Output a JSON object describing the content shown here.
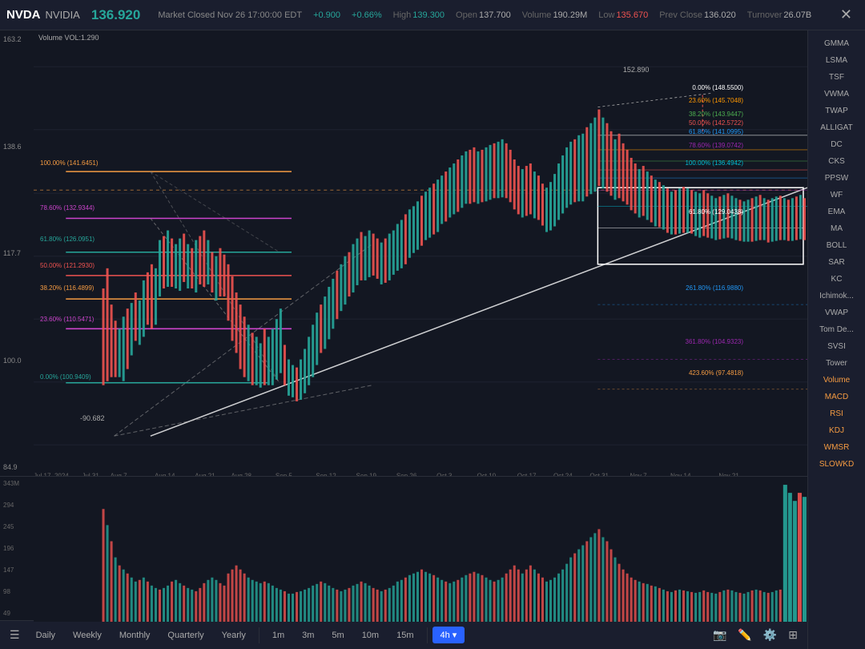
{
  "header": {
    "ticker": "NVDA",
    "company": "NVIDIA",
    "price": "136.920",
    "change": "+0.900",
    "change_pct": "+0.66%",
    "market_status": "Market Closed Nov 26 17:00:00 EDT",
    "high": "139.300",
    "low": "135.670",
    "open": "137.700",
    "prev_close": "136.020",
    "volume": "190.29M",
    "turnover": "26.07B"
  },
  "sidebar": {
    "items": [
      {
        "label": "GMMA",
        "color": "normal"
      },
      {
        "label": "LSMA",
        "color": "normal"
      },
      {
        "label": "TSF",
        "color": "normal"
      },
      {
        "label": "VWMA",
        "color": "normal"
      },
      {
        "label": "TWAP",
        "color": "normal"
      },
      {
        "label": "ALLIGAT",
        "color": "normal"
      },
      {
        "label": "DC",
        "color": "normal"
      },
      {
        "label": "CKS",
        "color": "normal"
      },
      {
        "label": "PPSW",
        "color": "normal"
      },
      {
        "label": "WF",
        "color": "normal"
      },
      {
        "label": "EMA",
        "color": "normal"
      },
      {
        "label": "MA",
        "color": "normal"
      },
      {
        "label": "BOLL",
        "color": "normal"
      },
      {
        "label": "SAR",
        "color": "normal"
      },
      {
        "label": "KC",
        "color": "normal"
      },
      {
        "label": "Ichimok...",
        "color": "normal"
      },
      {
        "label": "VWAP",
        "color": "normal"
      },
      {
        "label": "Tom De...",
        "color": "normal"
      },
      {
        "label": "SVSI",
        "color": "normal"
      },
      {
        "label": "Tower",
        "color": "normal"
      },
      {
        "label": "Volume",
        "color": "orange"
      },
      {
        "label": "MACD",
        "color": "orange"
      },
      {
        "label": "RSI",
        "color": "orange"
      },
      {
        "label": "KDJ",
        "color": "orange"
      },
      {
        "label": "WMSR",
        "color": "orange"
      },
      {
        "label": "SLOWKD",
        "color": "orange"
      }
    ]
  },
  "timeframes": {
    "buttons": [
      "Daily",
      "Weekly",
      "Monthly",
      "Quarterly",
      "Yearly",
      "1m",
      "3m",
      "5m",
      "10m",
      "15m",
      "4h"
    ],
    "active": "4h"
  },
  "chart": {
    "y_labels": [
      "163.2",
      "138.6",
      "117.7",
      "100.0",
      "84.9"
    ],
    "date_labels": [
      "Jul 17, 2024",
      "Jul 31",
      "Aug 7",
      "Aug 14",
      "Aug 21",
      "Aug 28",
      "Sep 5",
      "Sep 12",
      "Sep 19",
      "Sep 26",
      "Oct 3",
      "Oct 10",
      "Oct 17",
      "Oct 24",
      "Oct 31",
      "Nov 7",
      "Nov 14",
      "Nov 21"
    ],
    "fib_levels_left": [
      {
        "label": "100.00% (141.6451)",
        "color": "#f59b42",
        "top_pct": 31
      },
      {
        "label": "78.60% (132.9344)",
        "color": "#cc44cc",
        "top_pct": 42
      },
      {
        "label": "61.80% (126.0951)",
        "color": "#26a69a",
        "top_pct": 49
      },
      {
        "label": "50.00% (121.2930)",
        "color": "#ef5350",
        "top_pct": 55
      },
      {
        "label": "38.20% (116.4899)",
        "color": "#f59b42",
        "top_pct": 61
      },
      {
        "label": "23.60% (110.5471)",
        "color": "#cc44cc",
        "top_pct": 68
      },
      {
        "label": "0.00% (100.9409)",
        "color": "#26a69a",
        "top_pct": 80
      }
    ],
    "fib_levels_right": [
      {
        "label": "0.00% (148.5500)",
        "color": "#fff",
        "top_pct": 14
      },
      {
        "label": "23.60% (145.7048)",
        "color": "#ff9800",
        "top_pct": 18
      },
      {
        "label": "38.20% (143.9447)",
        "color": "#4caf50",
        "top_pct": 21
      },
      {
        "label": "50.00% (142.5722)",
        "color": "#ef5350",
        "top_pct": 23
      },
      {
        "label": "61.80% (141.0995)",
        "color": "#2196f3",
        "top_pct": 25
      },
      {
        "label": "78.60% (139.0742)",
        "color": "#9c27b0",
        "top_pct": 28
      },
      {
        "label": "100.00% (136.4942)",
        "color": "#00bcd4",
        "top_pct": 32
      },
      {
        "label": "61.80% (129.0438)",
        "color": "#fff",
        "top_pct": 43
      }
    ],
    "extended_levels": [
      {
        "label": "261.80% (116.9880)",
        "color": "#2196f3",
        "top_pct": 61
      },
      {
        "label": "361.80% (104.9323)",
        "color": "#9c27b0",
        "top_pct": 73
      },
      {
        "label": "423.60% (97.4818)",
        "color": "#f59b42",
        "top_pct": 80
      }
    ],
    "peak_label": "152.890",
    "low_label": "-90.682",
    "volume_label": "Volume VOL:1.290",
    "volume_y": [
      "343M",
      "294",
      "245",
      "196",
      "147",
      "98",
      "49"
    ]
  }
}
